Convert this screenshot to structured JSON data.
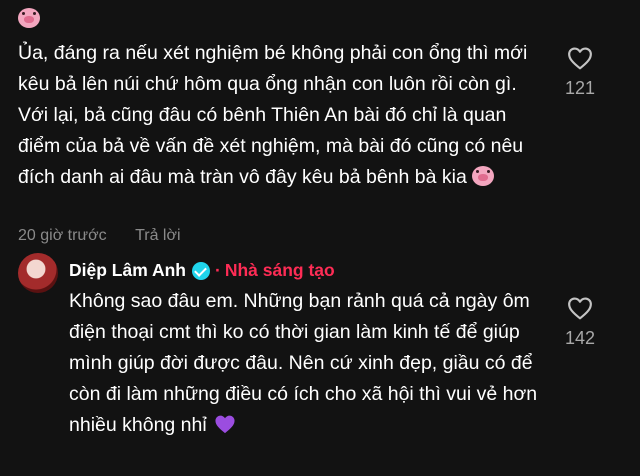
{
  "comment": {
    "text": "Ủa, đáng ra nếu xét nghiệm bé không phải con ổng thì mới kêu bả lên núi chứ hôm qua ổng nhận con luôn rồi còn gì. Với lại, bả cũng đâu có bênh Thiên An bài đó chỉ là quan điểm của bả về vấn đề xét nghiệm, mà bài đó cũng có nêu đích danh ai đâu mà tràn vô đây kêu bả bênh bà kia",
    "time": "20 giờ trước",
    "reply_label": "Trả lời",
    "like_count": "121",
    "top_emoji": "pig-face",
    "end_emoji": "pig-face"
  },
  "reply": {
    "author": "Diệp Lâm Anh",
    "separator": "·",
    "badge": "Nhà sáng tạo",
    "text": "Không sao đâu em. Những bạn rảnh quá cả ngày ôm điện thoại cmt thì ko có thời gian làm kinh tế để giúp mình giúp đời được đâu. Nên cứ xinh đẹp, giầu có để còn đi làm những điều có ích cho xã hội thì vui vẻ hơn nhiều không nhỉ",
    "like_count": "142",
    "end_emoji": "purple-heart"
  },
  "colors": {
    "background": "#121212",
    "text": "#ffffff",
    "muted": "#8a8a8a",
    "accent": "#fe2c55",
    "verified": "#20d5ec",
    "heart_emoji": "#9b4de0"
  }
}
